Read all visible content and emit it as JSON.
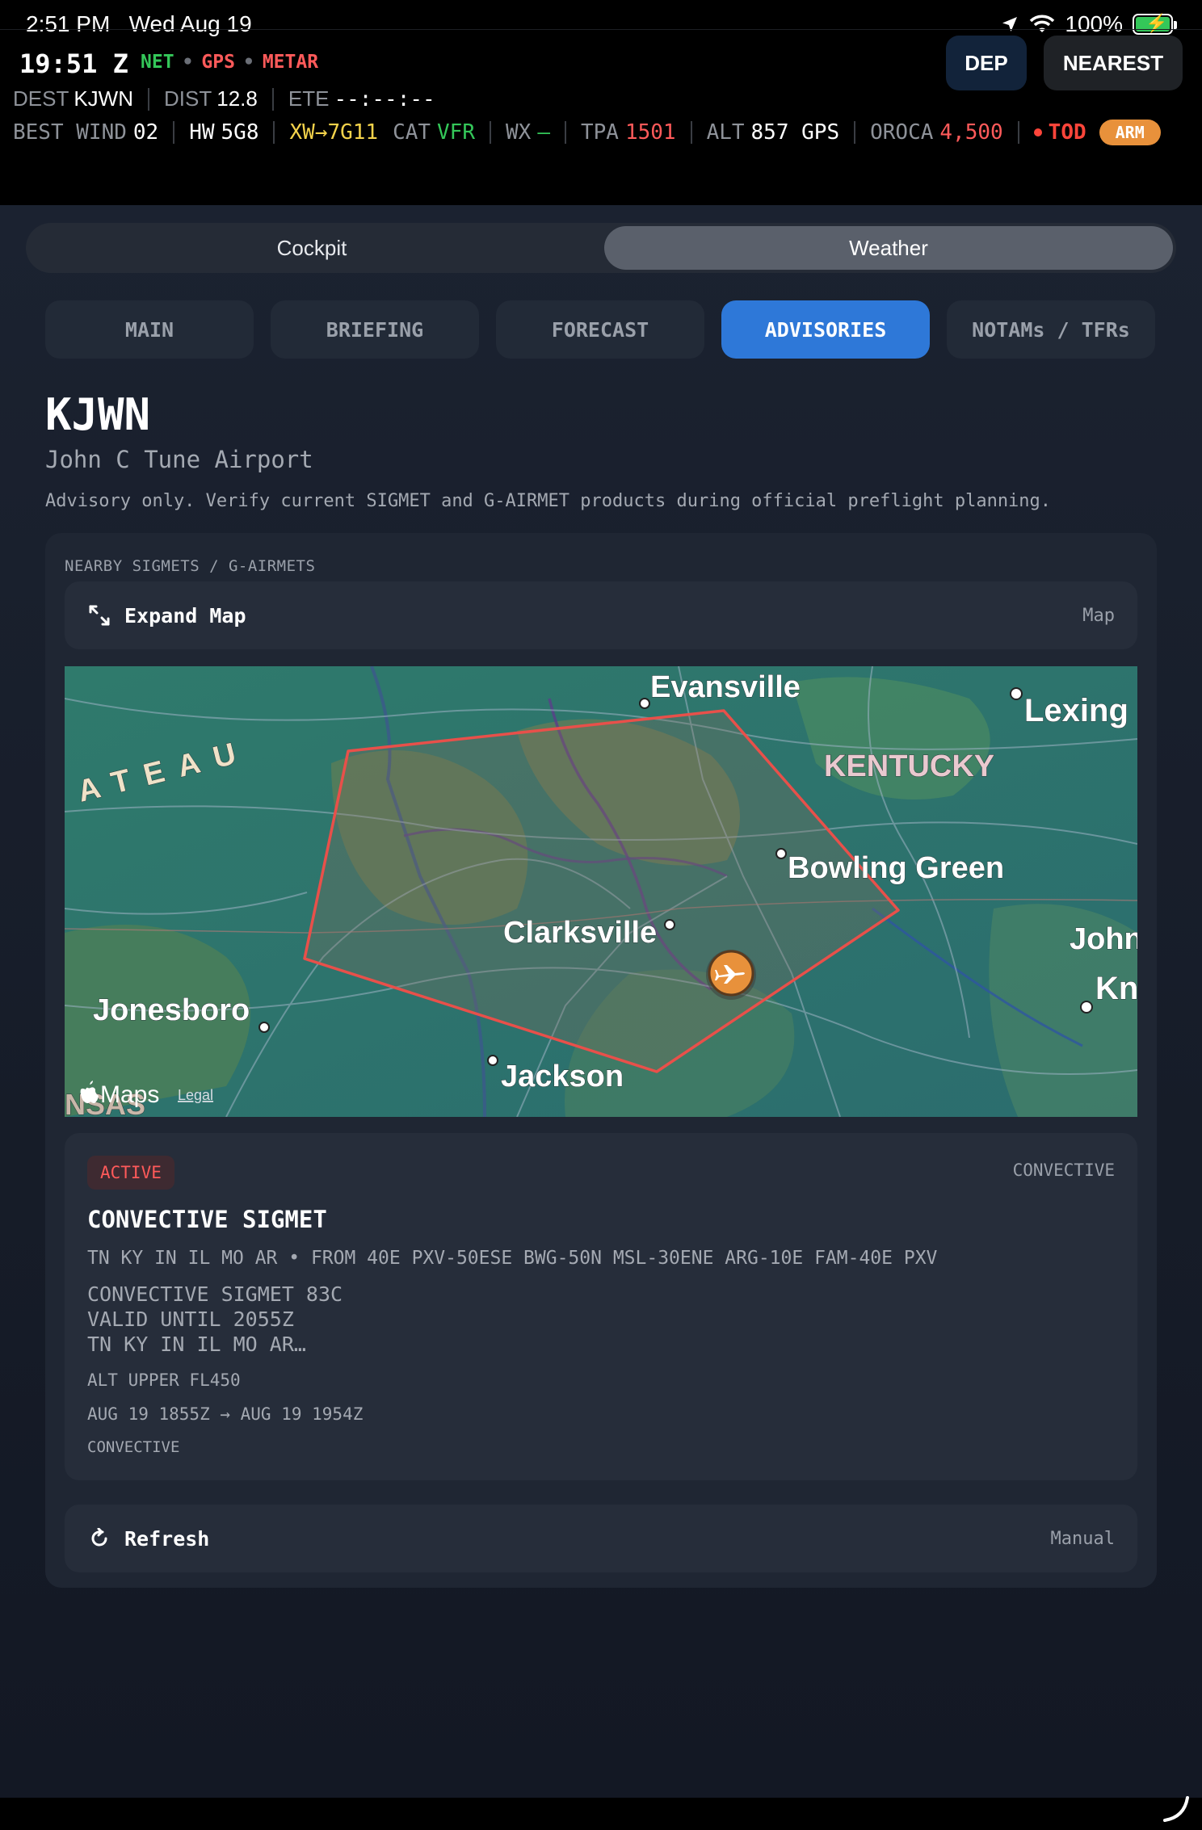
{
  "status": {
    "time": "2:51 PM",
    "date": "Wed Aug 19",
    "battery": "100%"
  },
  "header": {
    "zulu": "19:51 Z",
    "sources": [
      "NET",
      "GPS",
      "METAR"
    ],
    "dep_label": "DEP",
    "nearest_label": "NEAREST",
    "dest_label": "DEST",
    "dest_value": "KJWN",
    "dist_label": "DIST",
    "dist_value": "12.8",
    "ete_label": "ETE",
    "ete_value": "--:--:--",
    "best_wind_label": "BEST WIND",
    "best_wind_value": "02",
    "hw_label": "HW",
    "hw_value": "5G8",
    "xw_value": "XW→7G11",
    "cat_label": "CAT",
    "cat_value": "VFR",
    "wx_label": "WX",
    "wx_value": "—",
    "tpa_label": "TPA",
    "tpa_value": "1501",
    "alt_label": "ALT",
    "alt_value": "857 GPS",
    "oroca_label": "OROCA",
    "oroca_value": "4,500",
    "tod_label": "TOD",
    "arm_label": "ARM"
  },
  "segment": {
    "left": "Cockpit",
    "right": "Weather",
    "selected": "Weather"
  },
  "tabs": [
    {
      "label": "MAIN",
      "active": false
    },
    {
      "label": "BRIEFING",
      "active": false
    },
    {
      "label": "FORECAST",
      "active": false
    },
    {
      "label": "ADVISORIES",
      "active": true
    },
    {
      "label": "NOTAMs / TFRs",
      "active": false
    }
  ],
  "airport": {
    "id": "KJWN",
    "name": "John C Tune Airport",
    "advisory_note": "Advisory only. Verify current SIGMET and G-AIRMET products during official preflight planning."
  },
  "panel": {
    "title": "NEARBY SIGMETS / G-AIRMETS",
    "expand_label": "Expand Map",
    "expand_right": "Map",
    "refresh_label": "Refresh",
    "refresh_right": "Manual"
  },
  "map": {
    "attribution": "Maps",
    "legal": "Legal",
    "labels": {
      "evansville": "Evansville",
      "lexington": "Lexing",
      "kentucky": "KENTUCKY",
      "plateau": "ATEAU",
      "bowling_green": "Bowling Green",
      "clarksville": "Clarksville",
      "john": "John",
      "kn": "Kn",
      "jonesboro": "Jonesboro",
      "jackson": "Jackson",
      "nsas": "NSAS"
    },
    "polygon_color": "#e8504a",
    "aircraft_color": "#e8913b"
  },
  "sigmet": {
    "status": "ACTIVE",
    "type": "CONVECTIVE",
    "title": "CONVECTIVE SIGMET",
    "area": "TN KY IN IL MO AR • FROM 40E PXV-50ESE BWG-50N MSL-30ENE ARG-10E FAM-40E PXV",
    "raw_1": "CONVECTIVE SIGMET 83C",
    "raw_2": "VALID UNTIL 2055Z",
    "raw_3": "TN KY IN IL MO AR…",
    "alt": "ALT UPPER FL450",
    "valid": "AUG 19 1855Z → AUG 19 1954Z",
    "category": "CONVECTIVE"
  }
}
